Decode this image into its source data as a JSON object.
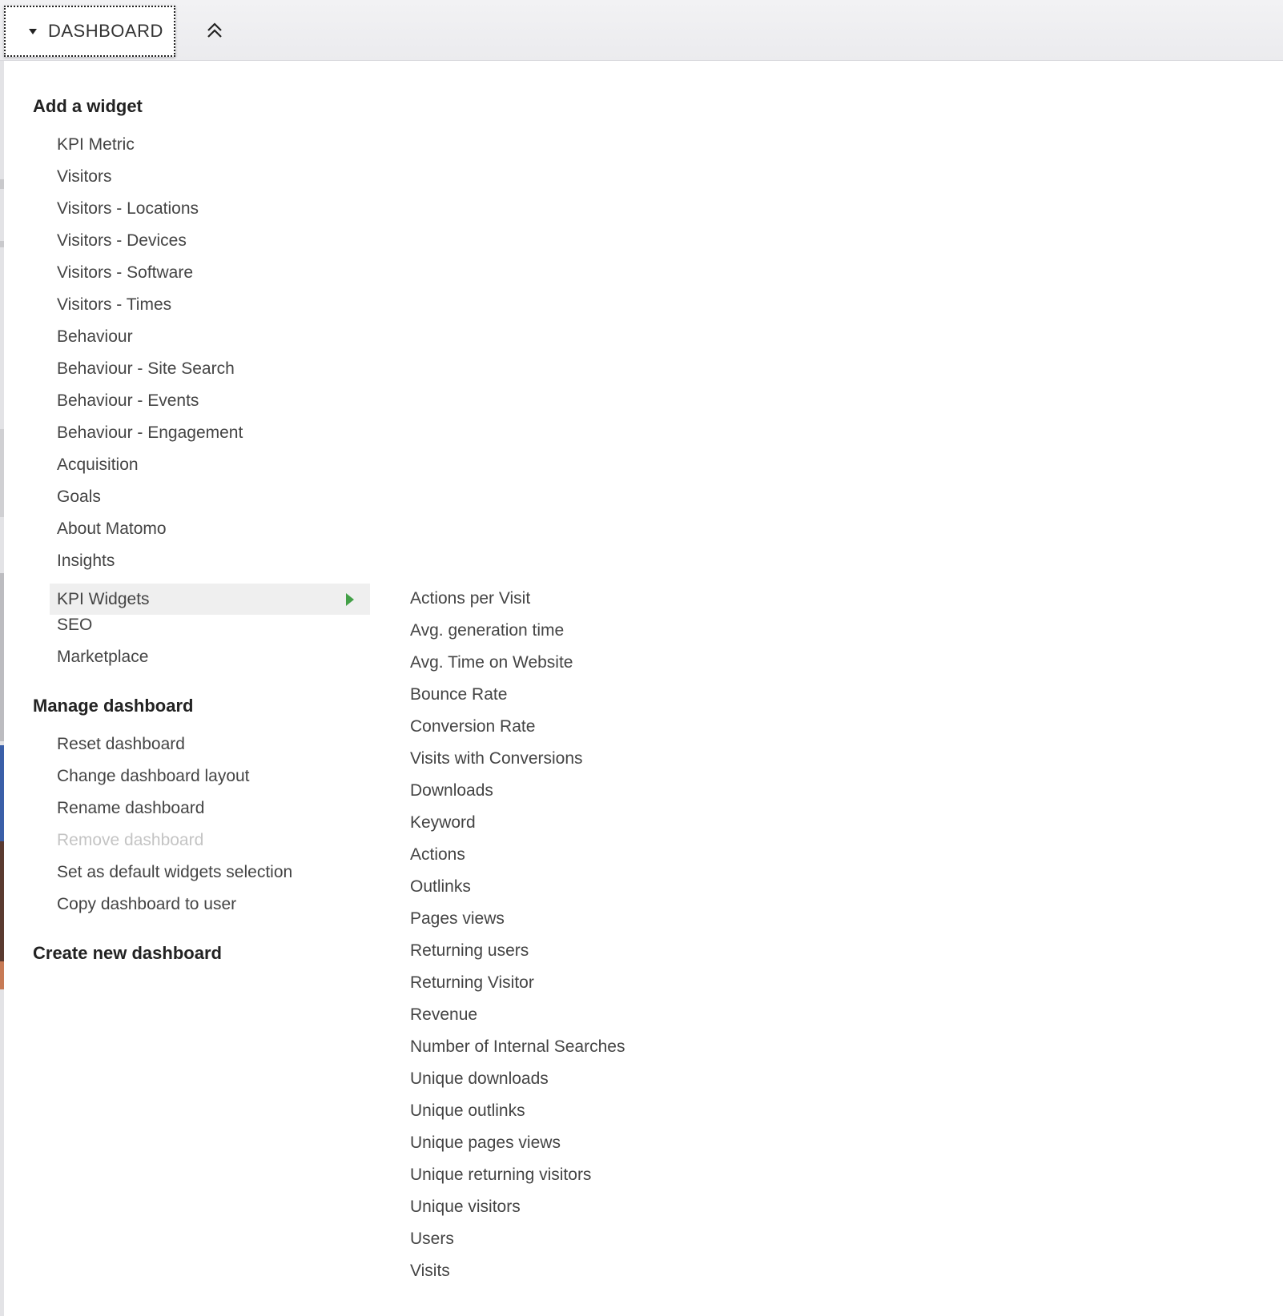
{
  "topbar": {
    "dashboard_label": "DASHBOARD"
  },
  "menu": {
    "add_widget_heading": "Add a widget",
    "widget_categories": [
      "KPI Metric",
      "Visitors",
      "Visitors - Locations",
      "Visitors - Devices",
      "Visitors - Software",
      "Visitors - Times",
      "Behaviour",
      "Behaviour - Site Search",
      "Behaviour - Events",
      "Behaviour - Engagement",
      "Acquisition",
      "Goals",
      "About Matomo",
      "Insights",
      "KPI Widgets",
      "SEO",
      "Marketplace"
    ],
    "manage_heading": "Manage dashboard",
    "manage_items": [
      "Reset dashboard",
      "Change dashboard layout",
      "Rename dashboard",
      "Remove dashboard",
      "Set as default widgets selection",
      "Copy dashboard to user"
    ],
    "create_heading": "Create new dashboard"
  },
  "submenu": {
    "items": [
      "Actions per Visit",
      "Avg. generation time",
      "Avg. Time on Website",
      "Bounce Rate",
      "Conversion Rate",
      "Visits with Conversions",
      "Downloads",
      "Keyword",
      "Actions",
      "Outlinks",
      "Pages views",
      "Returning users",
      "Returning Visitor",
      "Revenue",
      "Number of Internal Searches",
      "Unique downloads",
      "Unique outlinks",
      "Unique pages views",
      "Unique returning visitors",
      "Unique visitors",
      "Users",
      "Visits"
    ]
  },
  "colors": {
    "active_arrow": "#43a047",
    "disabled_text": "#c4c4c4"
  }
}
